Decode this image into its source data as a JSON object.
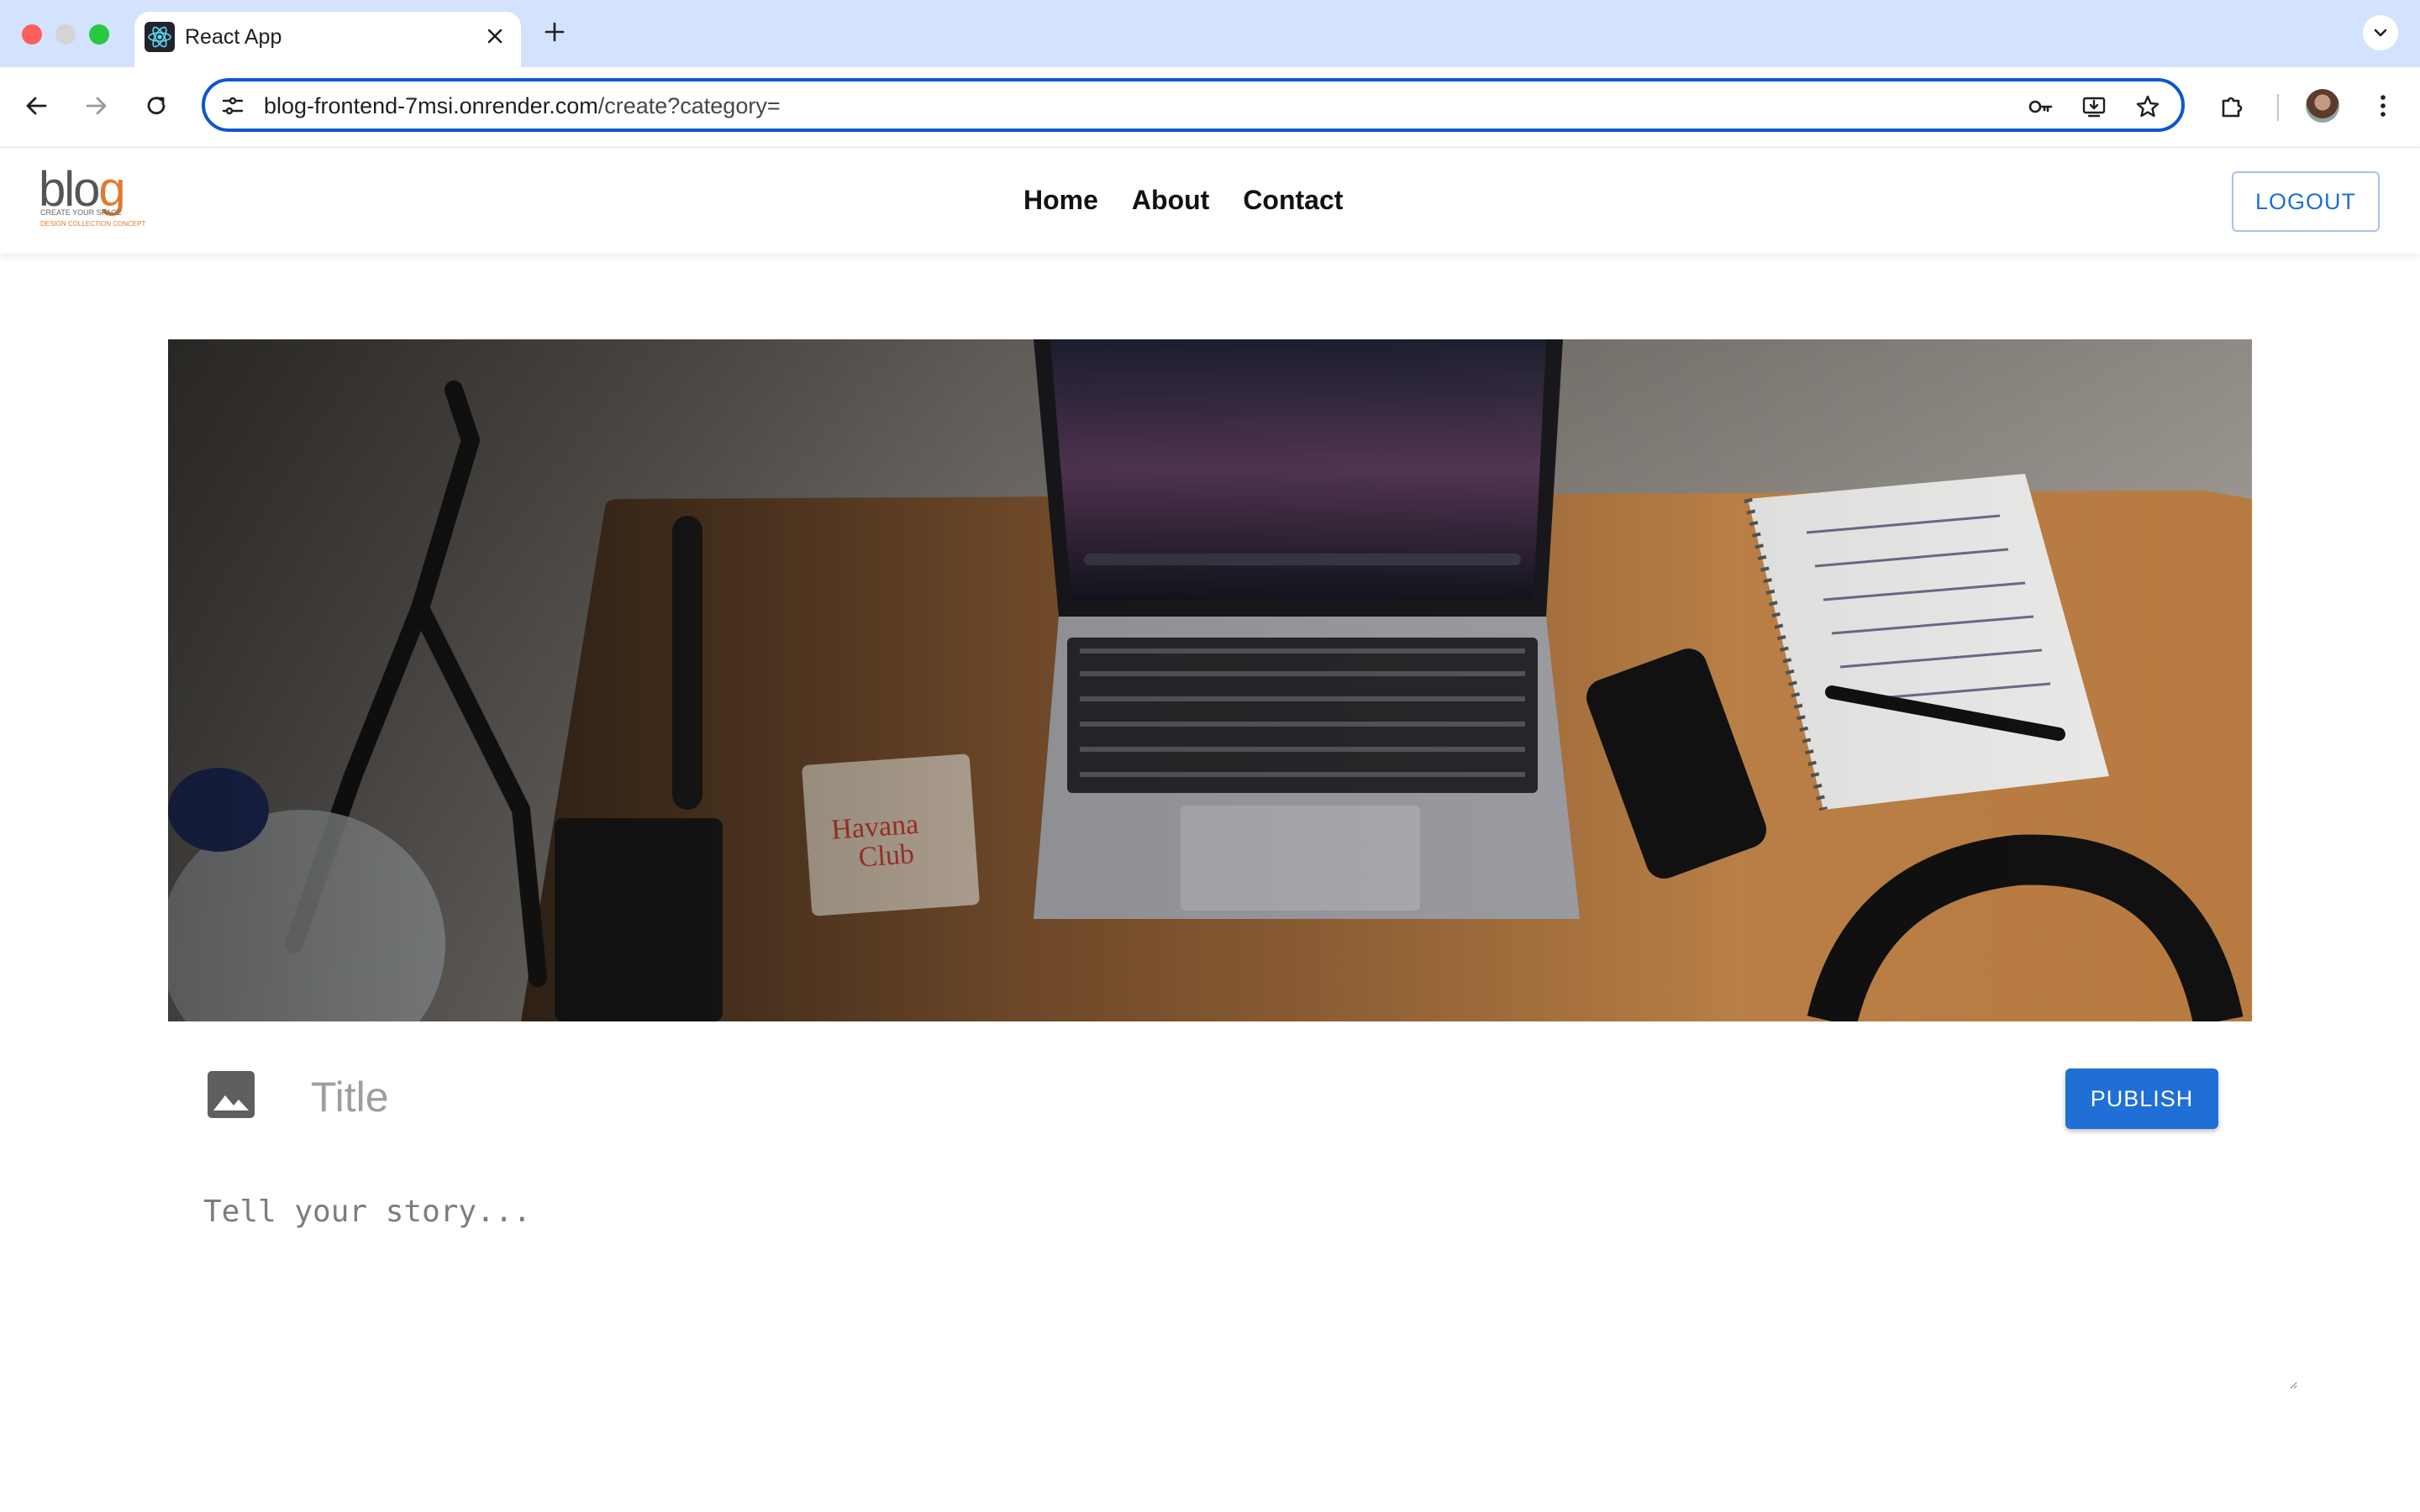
{
  "browser": {
    "tab_title": "React App",
    "url_host": "blog-frontend-7msi.onrender.com",
    "url_path": "/create?category="
  },
  "app": {
    "logo": {
      "main": "blo",
      "g": "g",
      "tagline": "CREATE YOUR SPACE",
      "subtagline": "DESIGN COLLECTION CONCEPT"
    },
    "nav": [
      "Home",
      "About",
      "Contact"
    ],
    "logout_label": "LOGOUT"
  },
  "editor": {
    "title_placeholder": "Title",
    "publish_label": "PUBLISH",
    "story_placeholder": "Tell your story..."
  },
  "colors": {
    "accent": "#1f6fd6",
    "tabstrip": "#d3e3fd",
    "omnibox_border": "#0b57d0",
    "logo_accent": "#e07a2e"
  },
  "icons": [
    "react-favicon-icon",
    "close-icon",
    "plus-icon",
    "chevron-down-icon",
    "back-icon",
    "forward-icon",
    "reload-icon",
    "tune-icon",
    "key-icon",
    "install-icon",
    "star-icon",
    "extensions-icon",
    "more-vert-icon",
    "image-icon"
  ]
}
